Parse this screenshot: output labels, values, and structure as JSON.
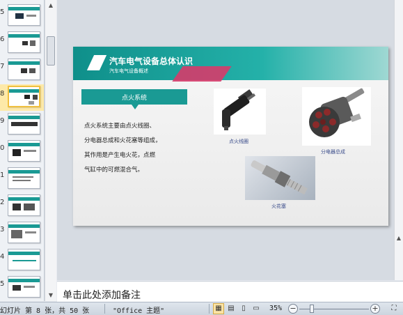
{
  "thumbnails": [
    {
      "num": "5"
    },
    {
      "num": "6"
    },
    {
      "num": "7"
    },
    {
      "num": "8",
      "selected": true
    },
    {
      "num": "9"
    },
    {
      "num": "0"
    },
    {
      "num": "1"
    },
    {
      "num": "2"
    },
    {
      "num": "3"
    },
    {
      "num": "4"
    },
    {
      "num": "5"
    }
  ],
  "slide": {
    "title": "汽车电气设备总体认识",
    "subtitle": "汽车电气设备概述",
    "section_label": "点火系统",
    "body_lines": [
      "点火系统主要由点火线圈、",
      "分电器总成和火花塞等组成，",
      "其作用是产生电火花，点燃",
      "气缸中的可燃混合气。"
    ],
    "captions": {
      "coil": "点火线圈",
      "distributor": "分电器总成",
      "spark_plug": "火花塞"
    }
  },
  "notes": {
    "placeholder": "单击此处添加备注"
  },
  "status": {
    "slide_info": "幻灯片 第 8 张，共 50 张",
    "theme": "\"Office 主题\"",
    "zoom": "35%",
    "zoom_level_percent": 35
  },
  "colors": {
    "accent": "#1a9a94",
    "highlight": "#fde9a8"
  }
}
